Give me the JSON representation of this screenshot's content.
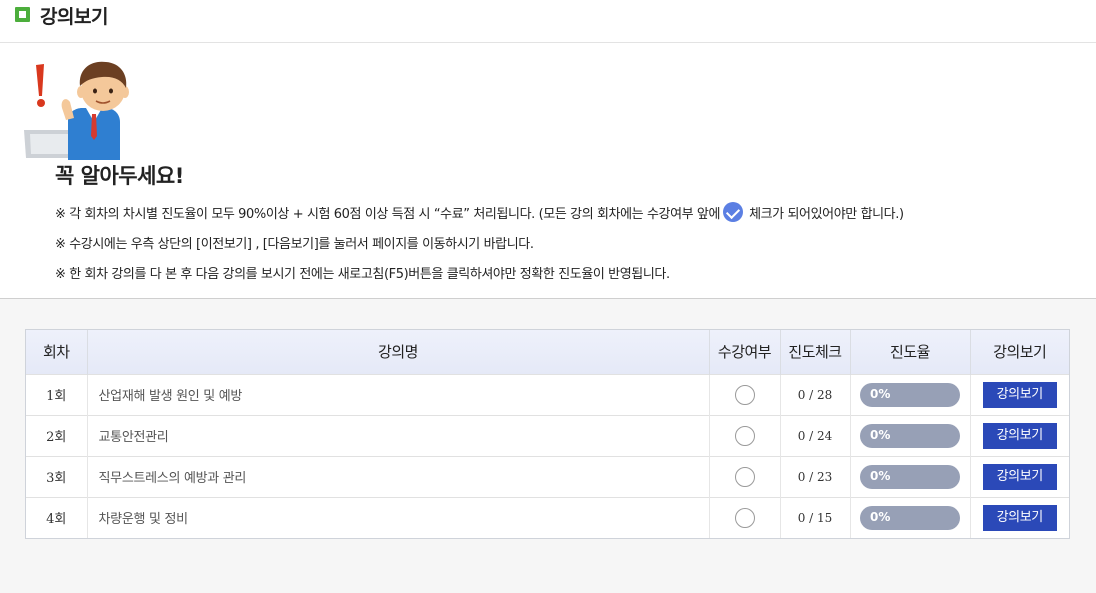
{
  "header": {
    "title": "강의보기"
  },
  "notice": {
    "title": "꼭 알아두세요!",
    "line1_before": "※ 각 회차의 차시별 진도율이 모두 90%이상 + 시험 60점 이상 득점 시 “수료” 처리됩니다. (모든 강의 회차에는 수강여부 앞에",
    "line1_after": "체크가 되어있어야만 합니다.)",
    "line2": "※ 수강시에는 우측 상단의 [이전보기] , [다음보기]를 눌러서 페이지를 이동하시기 바랍니다.",
    "line3": "※ 한 회차 강의를 다 본 후 다음 강의를 보시기 전에는 새로고침(F5)버튼을 클릭하셔야만 정확한 진도율이 반영됩니다."
  },
  "table": {
    "headers": [
      "회차",
      "강의명",
      "수강여부",
      "진도체크",
      "진도율",
      "강의보기"
    ],
    "rows": [
      {
        "session": "1회",
        "title": "산업재해 발생 원인 및 예방",
        "progress_check": "0 / 28",
        "rate": "0%",
        "rate_value": 0,
        "button": "강의보기"
      },
      {
        "session": "2회",
        "title": "교통안전관리",
        "progress_check": "0 / 24",
        "rate": "0%",
        "rate_value": 0,
        "button": "강의보기"
      },
      {
        "session": "3회",
        "title": "직무스트레스의 예방과 관리",
        "progress_check": "0 / 23",
        "rate": "0%",
        "rate_value": 0,
        "button": "강의보기"
      },
      {
        "session": "4회",
        "title": "차량운행 및 정비",
        "progress_check": "0 / 15",
        "rate": "0%",
        "rate_value": 0,
        "button": "강의보기"
      }
    ]
  },
  "colors": {
    "header_accent": "#4cae3c",
    "button": "#2b49b8",
    "progress_track": "#97a0b6",
    "check_badge": "#5b7fe3"
  },
  "icons": {
    "header": "square-bullet-icon",
    "character": "notice-character-illustration",
    "check": "checkmark-circle-icon",
    "status": "radio-circle-icon"
  }
}
